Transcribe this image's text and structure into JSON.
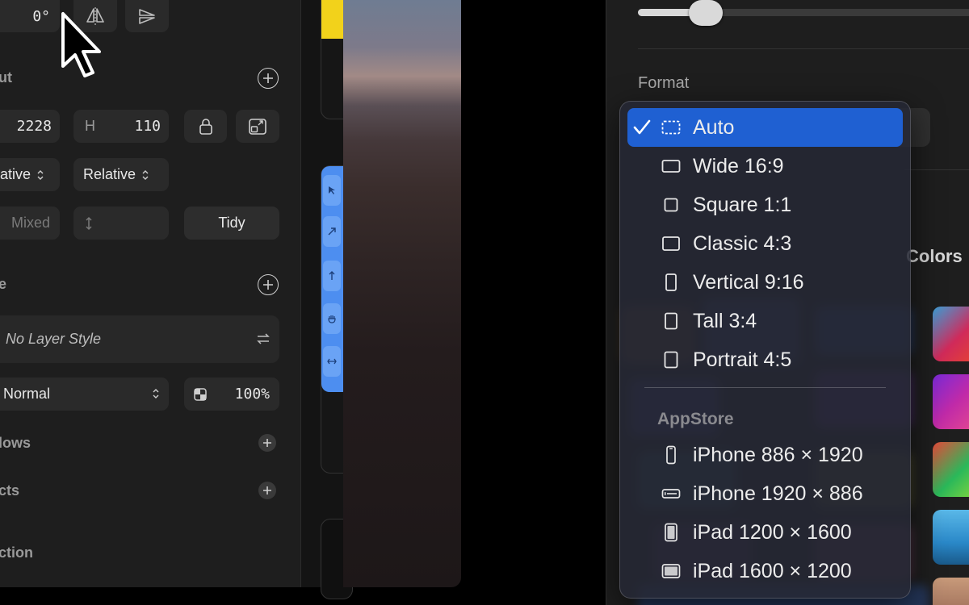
{
  "left_panel": {
    "rotation_value": "0°",
    "layout_heading": "ut",
    "width_value": "2228",
    "height_label": "H",
    "height_value": "110",
    "x_mode": "ative",
    "y_mode": "Relative",
    "spacing_placeholder": "Mixed",
    "tidy_label": "Tidy",
    "style_heading": "e",
    "layer_style_label": "No Layer Style",
    "blend_mode": "Normal",
    "opacity_value": "100%",
    "shadows_heading": "lows",
    "effects_heading": "cts",
    "interaction_heading": "ction"
  },
  "right_panel": {
    "format_label": "Format",
    "colors_label": "Colors"
  },
  "format_menu": {
    "items": [
      {
        "label": "Auto",
        "icon": "dashed-frame-icon",
        "selected": true
      },
      {
        "label": "Wide 16:9",
        "icon": "wide-frame-icon"
      },
      {
        "label": "Square 1:1",
        "icon": "square-frame-icon"
      },
      {
        "label": "Classic 4:3",
        "icon": "classic-frame-icon"
      },
      {
        "label": "Vertical 9:16",
        "icon": "vertical-frame-icon"
      },
      {
        "label": "Tall 3:4",
        "icon": "tall-frame-icon"
      },
      {
        "label": "Portrait 4:5",
        "icon": "portrait-frame-icon"
      }
    ],
    "section_heading": "AppStore",
    "device_items": [
      {
        "label": "iPhone 886 × 1920",
        "icon": "iphone-portrait-icon"
      },
      {
        "label": "iPhone 1920 × 886",
        "icon": "iphone-landscape-icon"
      },
      {
        "label": "iPad 1200 × 1600",
        "icon": "ipad-portrait-icon"
      },
      {
        "label": "iPad 1600 × 1200",
        "icon": "ipad-landscape-icon"
      }
    ]
  },
  "colors": {
    "accent": "#1f60d2",
    "panel_bg": "#1e1e1e",
    "field_bg": "#2a2a2a",
    "tool_strip_blue": "#4d8ef0",
    "tab_yellow": "#f2d21b"
  }
}
